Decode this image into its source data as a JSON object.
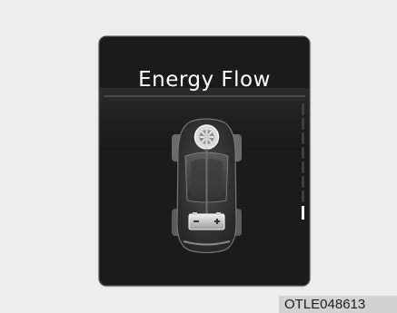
{
  "screen": {
    "title": "Energy Flow"
  },
  "scrollbar": {
    "segments": 8,
    "active_index": 7
  },
  "figure_code": "OTLE048613"
}
